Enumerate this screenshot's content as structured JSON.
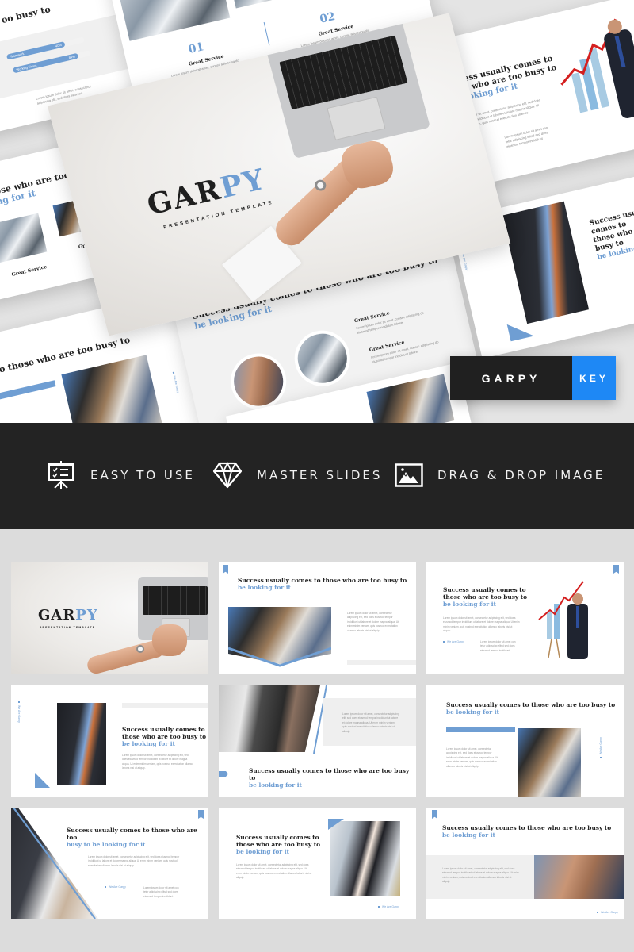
{
  "hero": {
    "cover_slide": {
      "logo_part1": "GAR",
      "logo_part2": "PY",
      "subtitle": "PRESENTATION TEMPLATE"
    },
    "slides": {
      "headline_main": "Success usually comes to those who are too busy to",
      "headline_highlight": "be looking for it",
      "headline_stacked_1": "Success usually comes to",
      "headline_stacked_2": "those who are too busy to",
      "headline_fragment_left": "oo busy to",
      "headline_fragment_left2": "those who are too busy",
      "headline_fragment_left3": "king for it",
      "headline_fragment_bottom": "s to those who are too busy to",
      "service_title": "Great Service",
      "service_text": "Lorem ipsum dolor sit amet, consec adipiscing do eiusmod tempor incididunt labore",
      "numbers": [
        "01",
        "02"
      ],
      "progress": [
        {
          "label": "Teamwork",
          "value_text": "40%",
          "value": 0.4
        },
        {
          "label": "Working Times",
          "value_text": "84%",
          "value": 0.84
        }
      ],
      "small_text": "Lorem ipsum dolor sit amet, consectetur adipiscing elit, sed does eiusmod.",
      "lorem_long": "Lorem ipsum dolor sit amet, consectetur adipiscing elit, sed does eiusmod tempor incididunt ut labore et dolore magna aliqua. Ut enim minim veniam, quis nostrud exercita tion ullamco.",
      "lorem_short": "Lorem ipsum dolor sit amet con tetur adipiscing elitsd sed does eiusmod tempor incididunt",
      "we_are": "We Are Garpy"
    },
    "badge": {
      "name": "GARPY",
      "format": "KEY",
      "colors": {
        "name_bg": "#202020",
        "format_bg": "#1e88f5"
      }
    }
  },
  "features": [
    {
      "icon": "presentation-board-icon",
      "label": "EASY TO USE"
    },
    {
      "icon": "diamond-icon",
      "label": "MASTER SLIDES"
    },
    {
      "icon": "image-icon",
      "label": "DRAG & DROP IMAGE"
    }
  ],
  "thumbnails": {
    "logo_part1": "GAR",
    "logo_part2": "PY",
    "logo_sub": "PRESENTATION TEMPLATE",
    "headline_main": "Success usually comes to those who are too busy to",
    "headline_highlight": "be looking for it",
    "headline_s1": "Success usually comes to",
    "headline_s2": "those who are too busy to",
    "headline_alt_main": "Success usually comes to those who are too",
    "headline_alt_highlight": "busy to be looking for it",
    "lorem_long": "Lorem ipsum dolor sit amet, consectetur adipiscing elit, sed does eiusmod tempor incididunt ut labore et dolore magna aliqua. Ut enim minim veniam, quis nostrud exercitation ullamco laboris nisi ut aliquip.",
    "lorem_short": "Lorem ipsum dolor sit amet, consectetur adipiscing elit, sed does eiusmod.",
    "lorem_col": "Lorem ipsum dolor sit amet con tetur adipiscing elitsd sed does eiusmod tempor incididunt",
    "we_are": "We Are Garpy"
  },
  "colors": {
    "accent": "#6f9ed3",
    "feature_bar": "#232323",
    "grid_bg": "#dcdcdc"
  }
}
